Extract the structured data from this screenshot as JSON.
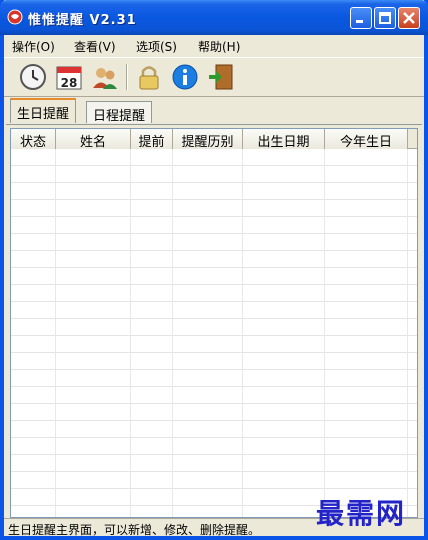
{
  "window": {
    "title": "惟惟提醒 V2.31"
  },
  "menu": {
    "items": [
      {
        "label": "操作(O)"
      },
      {
        "label": "查看(V)"
      },
      {
        "label": "选项(S)"
      },
      {
        "label": "帮助(H)"
      }
    ]
  },
  "toolbar": {
    "icons": [
      "clock-icon",
      "calendar-icon",
      "contacts-icon",
      "lock-icon",
      "info-icon",
      "exit-door-icon"
    ],
    "calendar_day": "28"
  },
  "tabs": [
    {
      "label": "生日提醒",
      "active": true
    },
    {
      "label": "日程提醒",
      "active": false
    }
  ],
  "table": {
    "columns": [
      "状态",
      "姓名",
      "提前",
      "提醒历别",
      "出生日期",
      "今年生日"
    ],
    "rows": []
  },
  "statusbar": {
    "text": "生日提醒主界面，可以新增、修改、删除提醒。"
  },
  "watermark": {
    "text": "最需网"
  },
  "colors": {
    "titlebar": "#0a58e0",
    "close_button": "#c8401e",
    "active_tab_accent": "#e68b2c",
    "watermark": "#2323c8"
  }
}
